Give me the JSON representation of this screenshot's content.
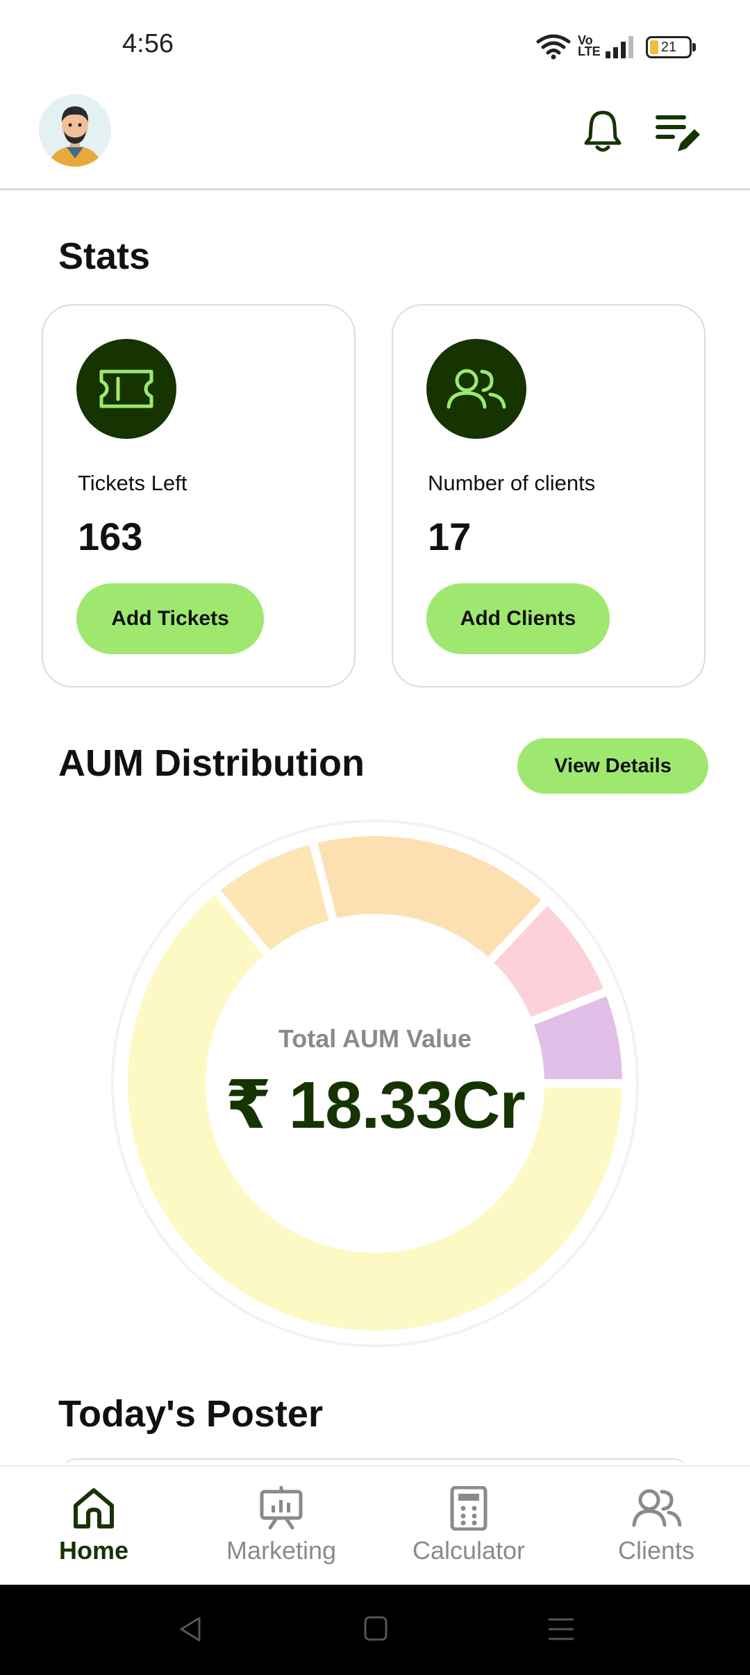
{
  "status_bar": {
    "time": "4:56",
    "battery_level": "21",
    "icons": [
      "wifi-icon",
      "volte-icon",
      "signal-icon",
      "battery-icon"
    ]
  },
  "header": {
    "avatar": "avatar",
    "icons": [
      "bell-icon",
      "menu-edit-icon"
    ],
    "accent_color": "#163302"
  },
  "stats": {
    "title": "Stats",
    "cards": [
      {
        "icon": "ticket-icon",
        "label": "Tickets Left",
        "value": "163",
        "button": "Add Tickets"
      },
      {
        "icon": "users-icon",
        "label": "Number of clients",
        "value": "17",
        "button": "Add Clients"
      }
    ]
  },
  "aum": {
    "title": "AUM Distribution",
    "view_details_label": "View Details",
    "center_label": "Total AUM Value",
    "center_value": "₹ 18.33Cr",
    "chart_data": {
      "type": "pie",
      "values": [
        0.64,
        0.07,
        0.16,
        0.07,
        0.06
      ],
      "colors": [
        "#fdf9c4",
        "#fde5b4",
        "#fde0b2",
        "#fdd1d9",
        "#e2bfe8"
      ]
    }
  },
  "poster": {
    "title": "Today's Poster"
  },
  "bottom_nav": {
    "items": [
      {
        "label": "Home",
        "icon": "home-icon",
        "active": true
      },
      {
        "label": "Marketing",
        "icon": "presentation-icon",
        "active": false
      },
      {
        "label": "Calculator",
        "icon": "calculator-icon",
        "active": false
      },
      {
        "label": "Clients",
        "icon": "users-icon",
        "active": false
      }
    ]
  },
  "system_nav": {
    "icons": [
      "back-icon",
      "home-square-icon",
      "recents-icon"
    ]
  }
}
